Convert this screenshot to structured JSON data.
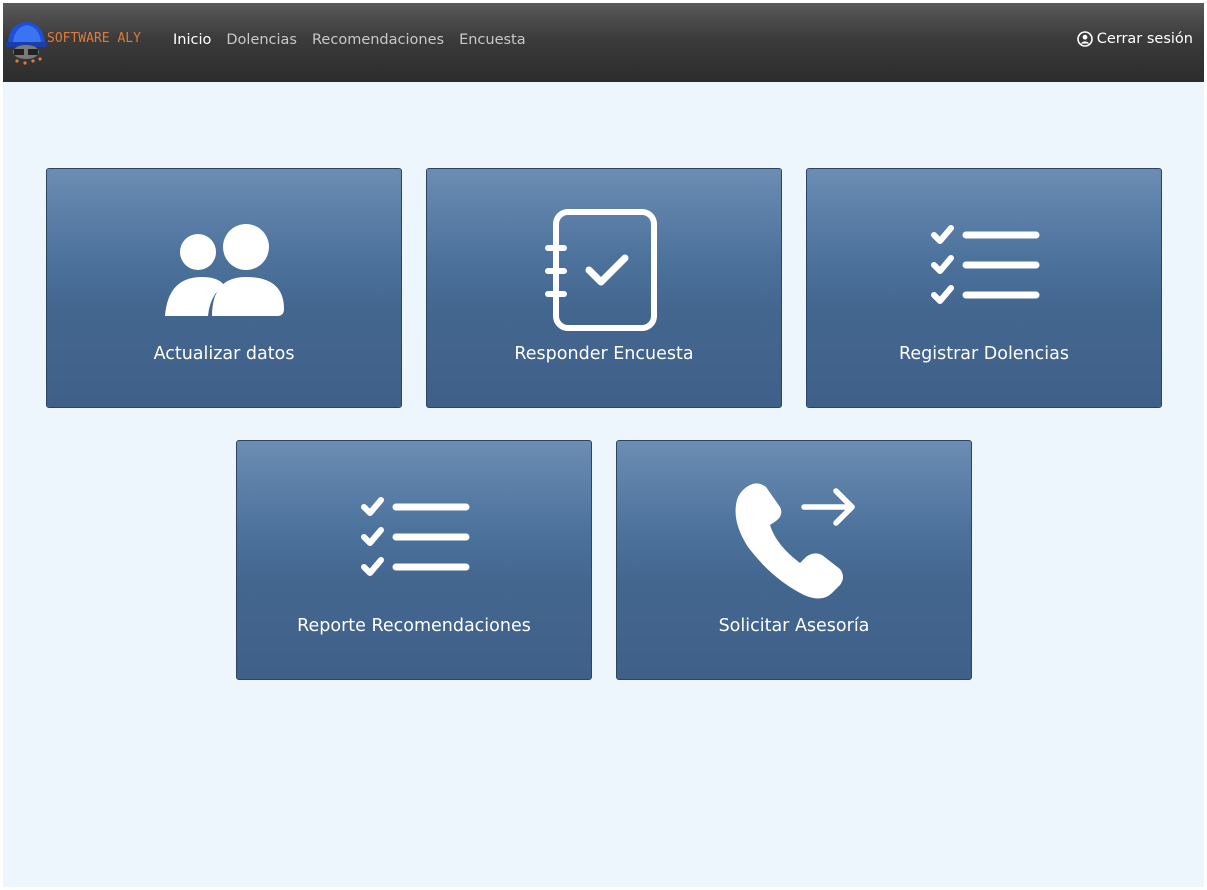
{
  "brand": {
    "name": "SOFTWARE ALY",
    "accent_color": "#e0793a"
  },
  "nav": {
    "items": [
      {
        "label": "Inicio",
        "active": true
      },
      {
        "label": "Dolencias",
        "active": false
      },
      {
        "label": "Recomendaciones",
        "active": false
      },
      {
        "label": "Encuesta",
        "active": false
      }
    ],
    "logout_label": "Cerrar sesión",
    "logout_icon": "user-circle-icon"
  },
  "cards": [
    {
      "label": "Actualizar datos",
      "icon": "users-icon"
    },
    {
      "label": "Responder Encuesta",
      "icon": "notebook-check-icon"
    },
    {
      "label": "Registrar Dolencias",
      "icon": "checklist-icon"
    },
    {
      "label": "Reporte Recomendaciones",
      "icon": "checklist-icon"
    },
    {
      "label": "Solicitar Asesoría",
      "icon": "phone-forward-icon"
    }
  ],
  "colors": {
    "navbar": "#2c2c2c",
    "page_background": "#eef6fd",
    "card_top": "#6c8db4",
    "card_bottom": "#3f6089"
  }
}
